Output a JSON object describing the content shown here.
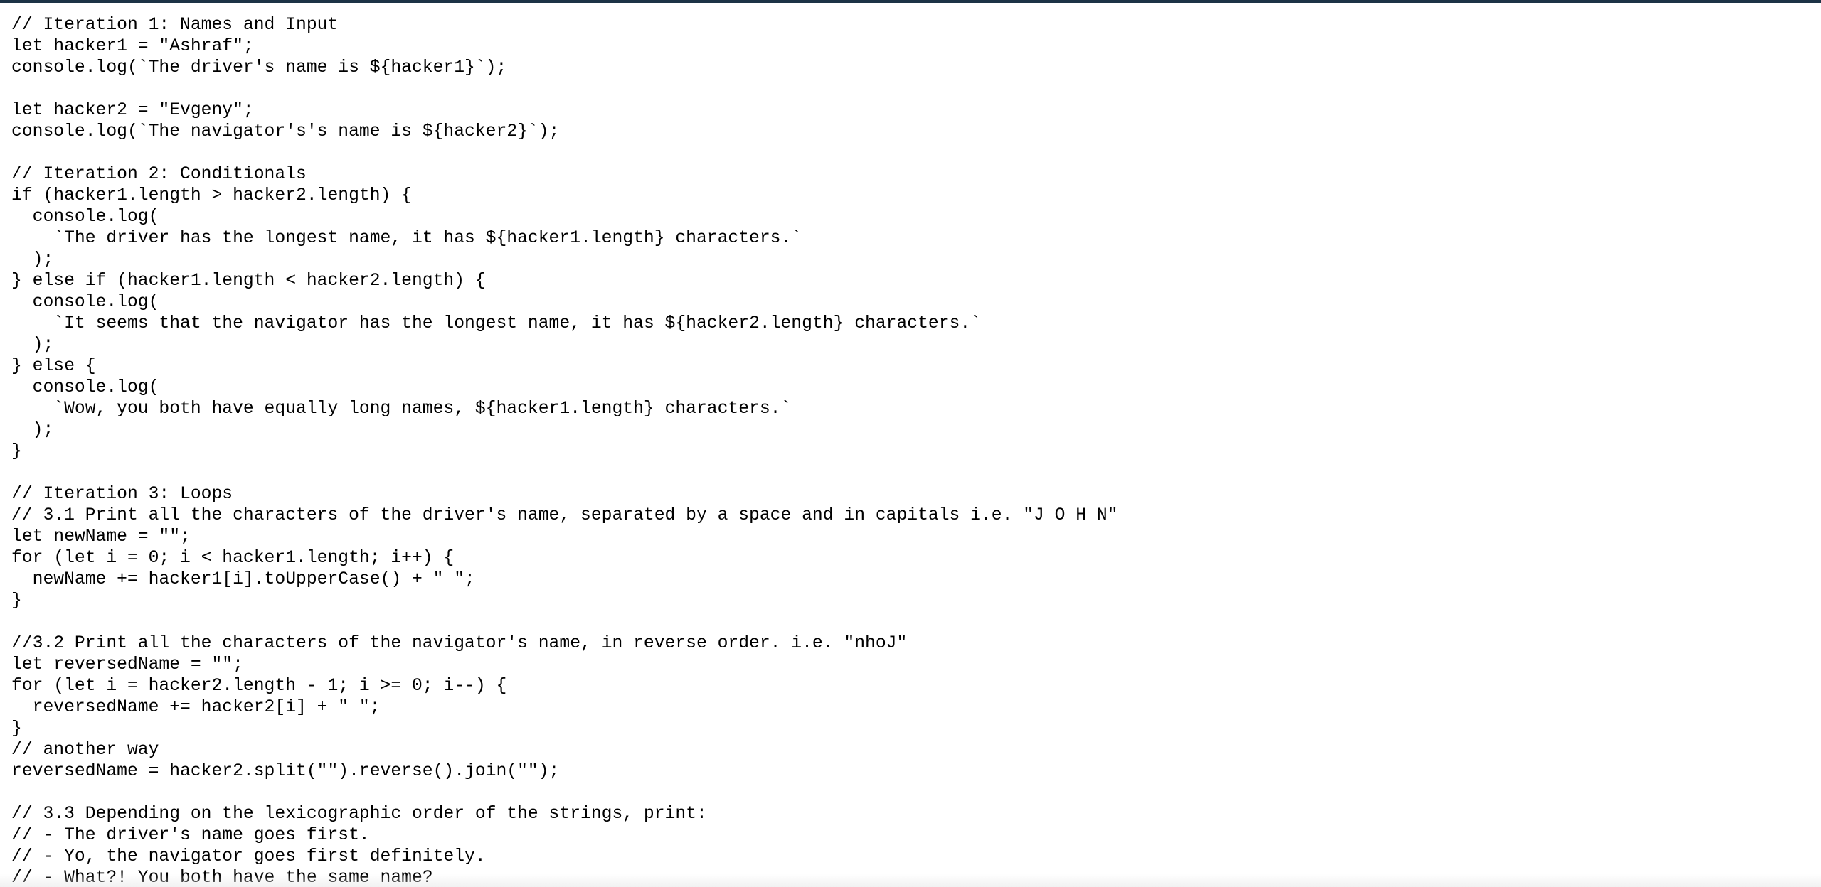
{
  "document": {
    "lines": [
      "// Iteration 1: Names and Input",
      "let hacker1 = \"Ashraf\";",
      "console.log(`The driver's name is ${hacker1}`);",
      "",
      "let hacker2 = \"Evgeny\";",
      "console.log(`The navigator's's name is ${hacker2}`);",
      "",
      "// Iteration 2: Conditionals",
      "if (hacker1.length > hacker2.length) {",
      "  console.log(",
      "    `The driver has the longest name, it has ${hacker1.length} characters.`",
      "  );",
      "} else if (hacker1.length < hacker2.length) {",
      "  console.log(",
      "    `It seems that the navigator has the longest name, it has ${hacker2.length} characters.`",
      "  );",
      "} else {",
      "  console.log(",
      "    `Wow, you both have equally long names, ${hacker1.length} characters.`",
      "  );",
      "}",
      "",
      "// Iteration 3: Loops",
      "// 3.1 Print all the characters of the driver's name, separated by a space and in capitals i.e. \"J O H N\"",
      "let newName = \"\";",
      "for (let i = 0; i < hacker1.length; i++) {",
      "  newName += hacker1[i].toUpperCase() + \" \";",
      "}",
      "",
      "//3.2 Print all the characters of the navigator's name, in reverse order. i.e. \"nhoJ\"",
      "let reversedName = \"\";",
      "for (let i = hacker2.length - 1; i >= 0; i--) {",
      "  reversedName += hacker2[i] + \" \";",
      "}",
      "// another way",
      "reversedName = hacker2.split(\"\").reverse().join(\"\");",
      "",
      "// 3.3 Depending on the lexicographic order of the strings, print:",
      "// - The driver's name goes first.",
      "// - Yo, the navigator goes first definitely.",
      "// - What?! You both have the same name?"
    ]
  },
  "colors": {
    "text": "#000000",
    "background": "#ffffff",
    "top_border": "#1d3346"
  }
}
